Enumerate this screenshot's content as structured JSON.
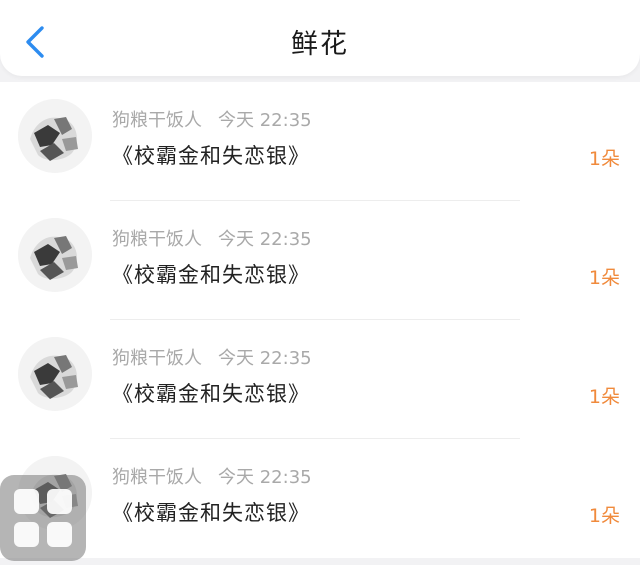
{
  "header": {
    "title": "鲜花",
    "back_icon": "chevron-left-icon",
    "accent_color": "#2d8cf0"
  },
  "items": [
    {
      "user": "狗粮干饭人",
      "time": "今天 22:35",
      "book": "《校霸金和失恋银》",
      "count": "1朵"
    },
    {
      "user": "狗粮干饭人",
      "time": "今天 22:35",
      "book": "《校霸金和失恋银》",
      "count": "1朵"
    },
    {
      "user": "狗粮干饭人",
      "time": "今天 22:35",
      "book": "《校霸金和失恋银》",
      "count": "1朵"
    },
    {
      "user": "狗粮干饭人",
      "time": "今天 22:35",
      "book": "《校霸金和失恋银》",
      "count": "1朵"
    }
  ],
  "colors": {
    "count": "#f08a3c",
    "meta": "#a9a9a9"
  },
  "floating_widget": {
    "icon": "grid-menu-icon"
  }
}
